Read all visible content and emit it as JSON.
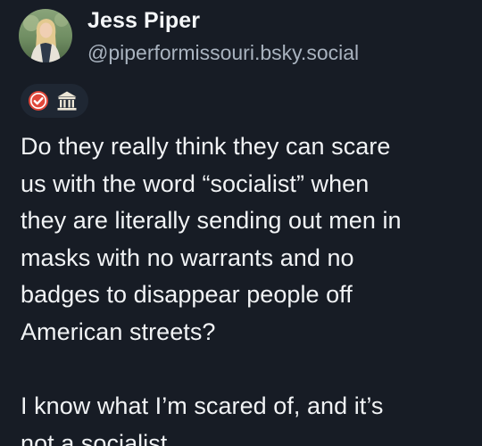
{
  "author": {
    "display_name": "Jess Piper",
    "handle": "@piperformissouri.bsky.social",
    "avatar_icon": "profile-photo"
  },
  "badges": {
    "icons": [
      "verified-check-icon",
      "government-building-icon"
    ],
    "colors": {
      "verified": "#e0473a",
      "building": "#ece6d6"
    }
  },
  "post": {
    "paragraphs": [
      "Do they really think they can scare\nus with the word “socialist” when\nthey are literally sending out men in\nmasks with no warrants and no\nbadges to disappear people off\nAmerican streets?",
      "I know what I’m scared of, and it’s\nnot a socialist."
    ]
  },
  "colors": {
    "background": "#171c25",
    "text": "#f1f3f5",
    "handle": "#a9b3bf",
    "badge_pill": "#1f2733"
  }
}
